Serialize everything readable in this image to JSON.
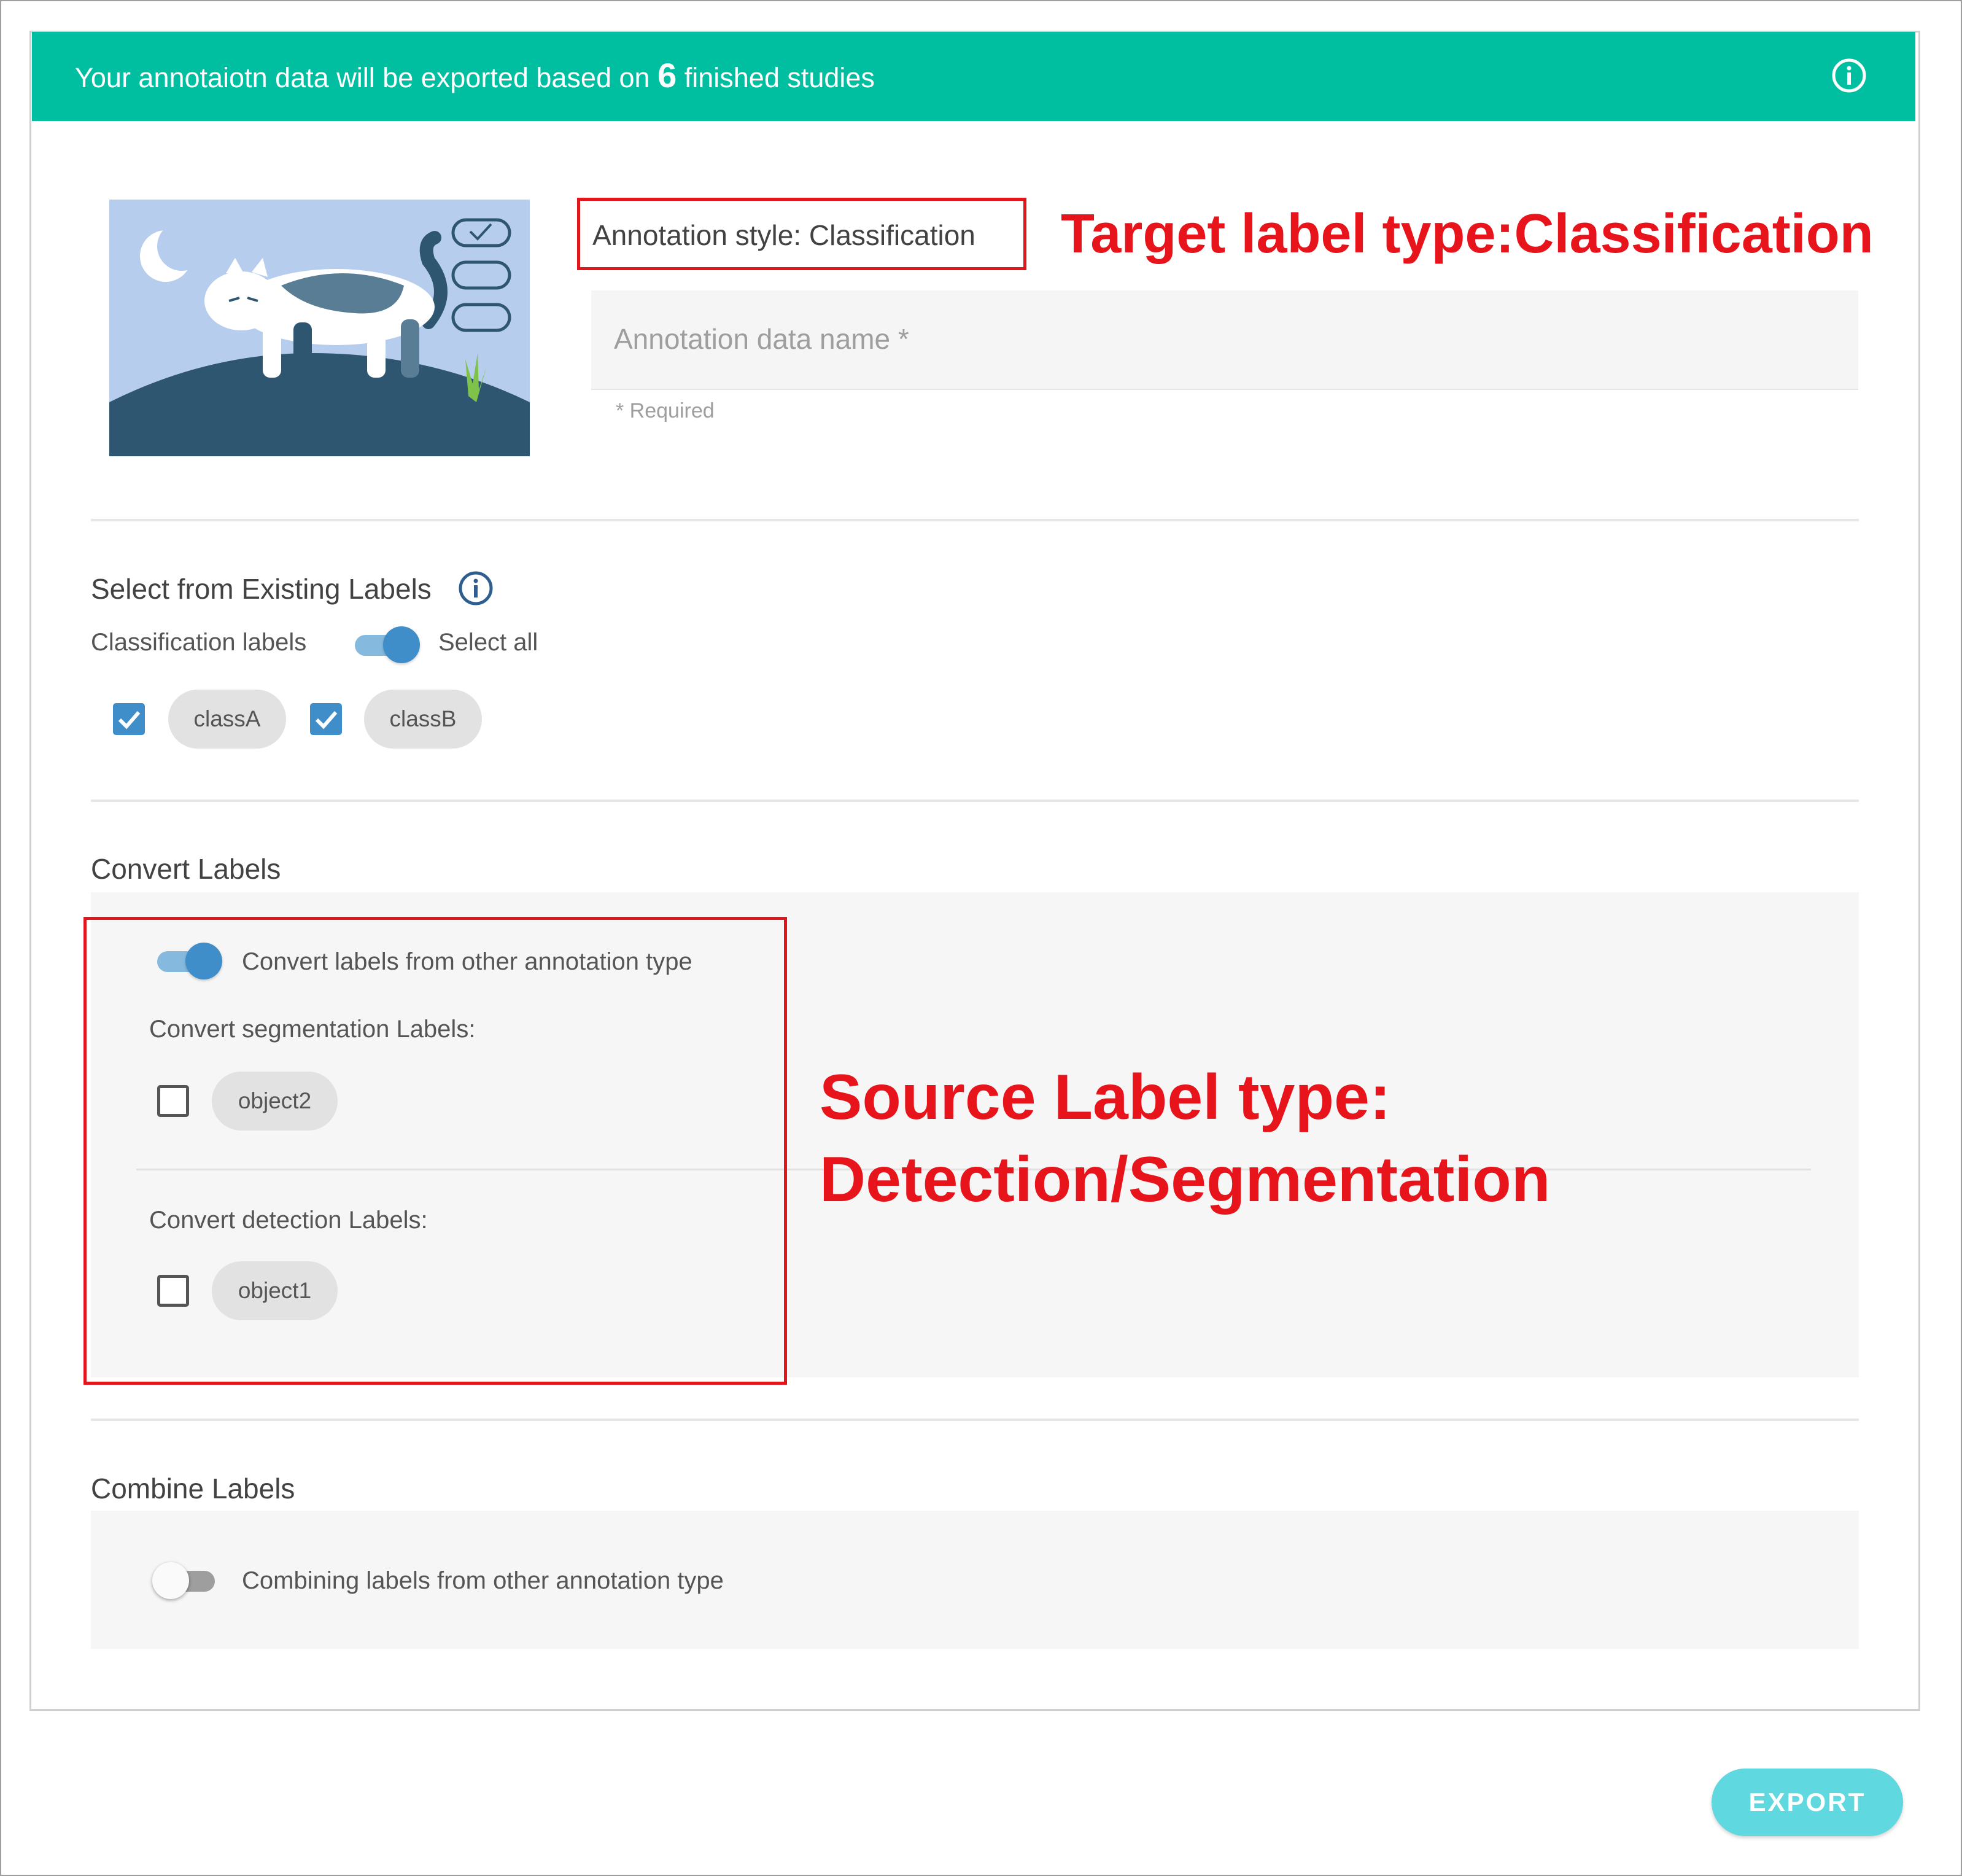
{
  "banner": {
    "prefix": "Your annotaiotn data will be exported based on",
    "count": "6",
    "suffix": "finished studies"
  },
  "header": {
    "annotation_style": "Annotation style: Classification",
    "target_note": "Target label type:Classification",
    "name_placeholder": "Annotation data name *",
    "required_hint": "* Required"
  },
  "existing_labels": {
    "title": "Select from Existing Labels",
    "classification_label": "Classification labels",
    "select_all_label": "Select all",
    "select_all_on": true,
    "items": [
      {
        "label": "classA",
        "checked": true
      },
      {
        "label": "classB",
        "checked": true
      }
    ]
  },
  "convert": {
    "title": "Convert Labels",
    "toggle_label": "Convert labels from other annotation type",
    "toggle_on": true,
    "segmentation_title": "Convert segmentation Labels:",
    "segmentation_items": [
      {
        "label": "object2",
        "checked": false
      }
    ],
    "detection_title": "Convert detection Labels:",
    "detection_items": [
      {
        "label": "object1",
        "checked": false
      }
    ],
    "source_note_line1": "Source Label type:",
    "source_note_line2": "Detection/Segmentation"
  },
  "combine": {
    "title": "Combine Labels",
    "toggle_label": "Combining labels from other annotation type",
    "toggle_on": false
  },
  "actions": {
    "export_label": "EXPORT"
  },
  "colors": {
    "banner": "#00bfa0",
    "accent": "#3f8ec9",
    "annotation_red": "#e8141b",
    "export_button": "#5fd8e0"
  },
  "icons": {
    "banner_info": "info-circle-icon",
    "labels_info": "info-circle-icon",
    "checkbox_checked": "checkmark-icon"
  }
}
